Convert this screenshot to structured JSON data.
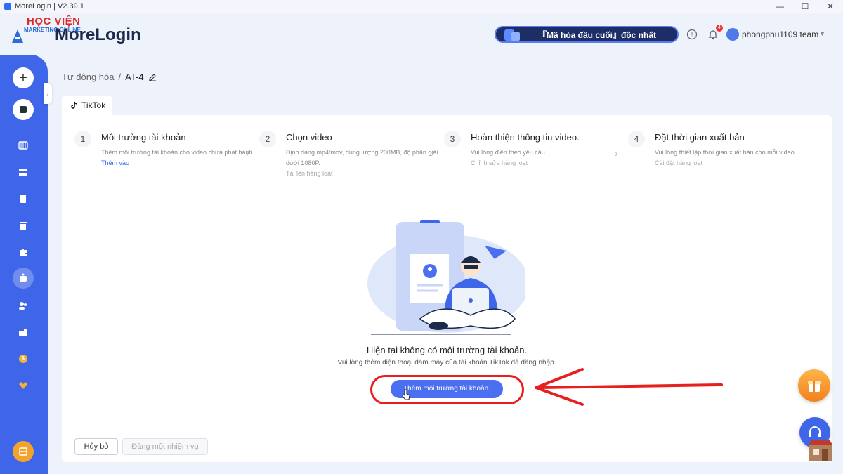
{
  "window": {
    "title": "MoreLogin | V2.39.1",
    "minimize": "—",
    "maximize": "☐",
    "close": "✕"
  },
  "logo": {
    "brand_top": "HỌC VIỆN",
    "brand_sub": "MARKETING ONLINE",
    "app_name": "MoreLogin"
  },
  "header": {
    "promo_text": "『Mã hóa đầu cuối』độc nhất",
    "notification_count": "4",
    "user_name": "phongphu1109 team",
    "icons": [
      "help-icon",
      "bell-icon",
      "user-avatar"
    ]
  },
  "sidebar": {
    "add_label": "+",
    "icons": [
      "add-icon",
      "profile-icon",
      "browser-icon",
      "group-icon",
      "clipboard-icon",
      "trash-icon",
      "extension-icon",
      "automation-icon",
      "team-icon",
      "api-icon",
      "clock-icon",
      "vip-icon",
      "gift-icon"
    ],
    "collapse_label": "›"
  },
  "breadcrumb": {
    "parent": "Tự động hóa",
    "separator": "/",
    "current": "AT-4"
  },
  "tab": {
    "label": "TikTok"
  },
  "steps": [
    {
      "num": "1",
      "title": "Môi trường tài khoản",
      "desc": "Thêm môi trường tài khoản cho video chưa phát hành.",
      "link": "Thêm vào"
    },
    {
      "num": "2",
      "title": "Chọn video",
      "desc": "Định dạng mp4/mov, dung lượng 200MB, độ phân giải dưới 1080P.",
      "link": "Tải lên hàng loạt"
    },
    {
      "num": "3",
      "title": "Hoàn thiện thông tin video.",
      "desc": "Vui lòng điền theo yêu cầu.",
      "link": "Chỉnh sửa hàng loạt"
    },
    {
      "num": "4",
      "title": "Đặt thời gian xuất bản",
      "desc": "Vui lòng thiết lập thời gian xuất bản cho mỗi video.",
      "link": "Cài đặt hàng loạt"
    }
  ],
  "empty_state": {
    "title": "Hiện tại không có môi trường tài khoản.",
    "subtitle": "Vui lòng thêm điện thoại đám mây của tài khoản TikTok đã đăng nhập.",
    "button": "Thêm môi trường tài khoản."
  },
  "footer": {
    "cancel": "Hủy bỏ",
    "post": "Đăng một nhiệm vụ"
  },
  "colors": {
    "primary": "#3f66e8",
    "highlight": "#e81f1f",
    "background": "#eef2fa"
  }
}
